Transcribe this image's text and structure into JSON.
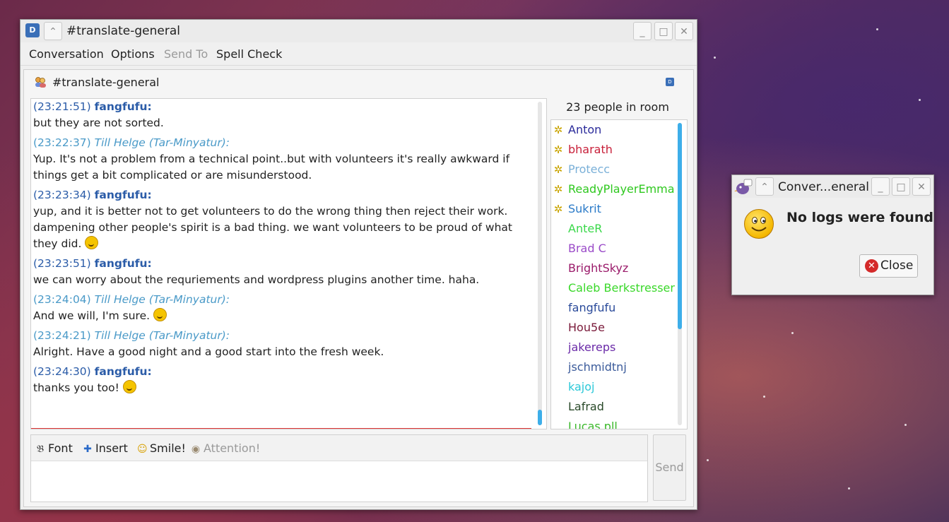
{
  "window": {
    "title": "#translate-general",
    "menu": {
      "conversation": "Conversation",
      "options": "Options",
      "send_to": "Send To",
      "spell_check": "Spell Check"
    }
  },
  "conversation": {
    "title": "#translate-general",
    "people_count": "23 people in room",
    "messages": [
      {
        "time": "(23:21:51)",
        "nick": "fangfufu:",
        "text": "but they are not sorted."
      },
      {
        "time": "(23:22:37)",
        "nick": "Till Helge (Tar-Minyatur):",
        "text": "Yup. It's not a problem from a technical point..but with volunteers it's really awkward if things get a bit complicated or are misunderstood."
      },
      {
        "time": "(23:23:34)",
        "nick": "fangfufu:",
        "text": "yup, and it is better not to get volunteers to do the wrong thing then reject their work. dampening other people's spirit is a bad thing. we want volunteers to be proud of what they did."
      },
      {
        "time": "(23:23:51)",
        "nick": "fangfufu:",
        "text": "we can worry about the requriements and wordpress plugins another time. haha."
      },
      {
        "time": "(23:24:04)",
        "nick": "Till Helge (Tar-Minyatur):",
        "text": "And we will, I'm sure."
      },
      {
        "time": "(23:24:21)",
        "nick": "Till Helge (Tar-Minyatur):",
        "text": "Alright. Have a good night and a good start into the fresh week."
      },
      {
        "time": "(23:24:30)",
        "nick": "fangfufu:",
        "text": "thanks you too!"
      }
    ],
    "buddies": [
      {
        "name": "Anton",
        "op": true,
        "color": "#2a2a9a"
      },
      {
        "name": "bharath",
        "op": true,
        "color": "#c8203a"
      },
      {
        "name": "Protecc",
        "op": true,
        "color": "#7ab0d8"
      },
      {
        "name": "ReadyPlayerEmma",
        "op": true,
        "color": "#2ec81e"
      },
      {
        "name": "Sukrit",
        "op": true,
        "color": "#2a7ac8"
      },
      {
        "name": "AnteR",
        "op": false,
        "color": "#3ad84a"
      },
      {
        "name": "Brad C",
        "op": false,
        "color": "#9a4ac8"
      },
      {
        "name": "BrightSkyz",
        "op": false,
        "color": "#9a1a6a"
      },
      {
        "name": "Caleb Berkstresser",
        "op": false,
        "color": "#3ad82a"
      },
      {
        "name": "fangfufu",
        "op": false,
        "color": "#2a4a9a"
      },
      {
        "name": "Hou5e",
        "op": false,
        "color": "#7a1a3a"
      },
      {
        "name": "jakereps",
        "op": false,
        "color": "#6a2aa8"
      },
      {
        "name": "jschmidtnj",
        "op": false,
        "color": "#3a5a9a"
      },
      {
        "name": "kajoj",
        "op": false,
        "color": "#2ac8d8"
      },
      {
        "name": "Lafrad",
        "op": false,
        "color": "#2a4a2a"
      },
      {
        "name": "Lucas.pll",
        "op": false,
        "color": "#3ab82a"
      }
    ],
    "toolbar": {
      "font": "Font",
      "insert": "Insert",
      "smile": "Smile!",
      "attention": "Attention!"
    },
    "send": "Send"
  },
  "dialog": {
    "title": "Conver...eneral",
    "message": "No logs were found",
    "close": "Close"
  }
}
